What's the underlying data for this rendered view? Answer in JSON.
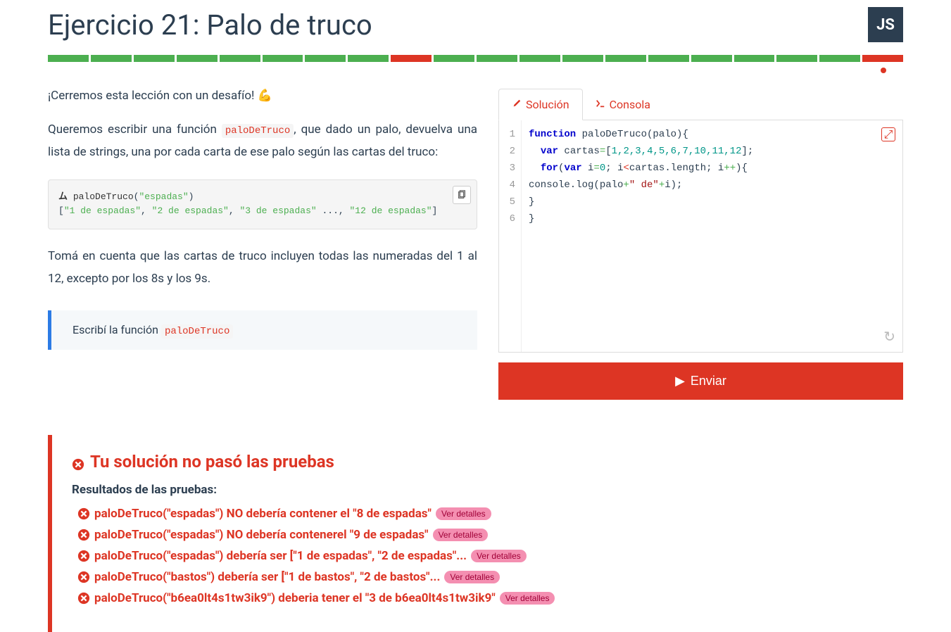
{
  "header": {
    "title": "Ejercicio 21:  Palo de truco",
    "lang": "JS"
  },
  "progress": [
    "green",
    "green",
    "green",
    "green",
    "green",
    "green",
    "green",
    "green",
    "red",
    "green",
    "green",
    "green",
    "green",
    "green",
    "green",
    "green",
    "green",
    "green",
    "green",
    "red"
  ],
  "description": {
    "intro": "¡Cerremos esta lección con un desafío! 💪",
    "p1_before": "Queremos escribir una función ",
    "p1_code": "paloDeTruco",
    "p1_after": ", que dado un palo, devuelva una lista de strings, una por cada carta de ese palo según las cartas del truco:",
    "example_prompt": "paloDeTruco",
    "example_arg": "\"espadas\"",
    "example_out": "[\"1 de espadas\", \"2 de espadas\", \"3 de espadas\" ..., \"12 de espadas\"]",
    "note": "Tomá en cuenta que las cartas de truco incluyen todas las numeradas del 1 al 12, excepto por los 8s y los 9s.",
    "task_before": "Escribí la función ",
    "task_code": "paloDeTruco"
  },
  "tabs": {
    "solution": "Solución",
    "console": "Consola"
  },
  "editor": {
    "lines": [
      "1",
      "2",
      "3",
      "4",
      "5",
      "6"
    ],
    "code": {
      "l1": {
        "kw1": "function",
        "fn": " paloDeTruco(palo){"
      },
      "l2": {
        "kw1": "var",
        "rest": " cartas",
        "eq": "=",
        "arr": "[",
        "nums": "1,2,3,4,5,6,7,10,11,12",
        "close": "];"
      },
      "l3": {
        "kw1": "for",
        "p1": "(",
        "kw2": "var",
        "p2": " i",
        "eq": "=",
        "zero": "0",
        "semi": "; i",
        "lt": "<",
        "mid": "cartas.length; i",
        "pp": "++",
        "end": "){"
      },
      "l4": {
        "indent": "    console.log(palo",
        "plus": "+",
        "str": "\" de\"",
        "plus2": "+",
        "rest": "i);"
      },
      "l5": "  }",
      "l6": "}"
    }
  },
  "submit": "Enviar",
  "results": {
    "title": "Tu solución no pasó las pruebas",
    "subtitle": "Resultados de las pruebas:",
    "details_label": "Ver detalles",
    "tests": [
      "paloDeTruco(\"espadas\") NO debería contener el \"8 de espadas\"",
      "paloDeTruco(\"espadas\") NO debería contenerel \"9 de espadas\"",
      "paloDeTruco(\"espadas\") debería ser [\"1 de espadas\", \"2 de espadas\"...",
      "paloDeTruco(\"bastos\") debería ser [\"1 de bastos\", \"2 de bastos\"...",
      "paloDeTruco(\"b6ea0lt4s1tw3ik9\") deberia tener el \"3 de b6ea0lt4s1tw3ik9\""
    ]
  }
}
